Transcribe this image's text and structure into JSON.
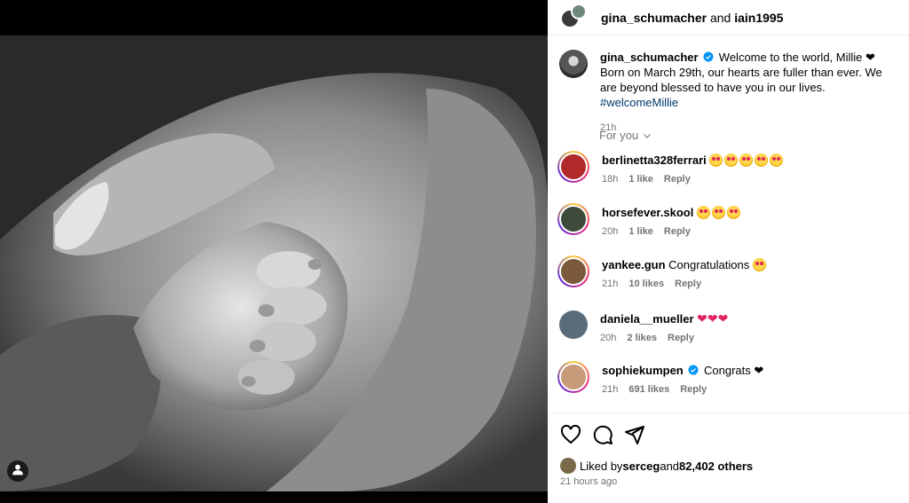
{
  "post": {
    "header_user1": "gina_schumacher",
    "header_and": " and ",
    "header_user2": "iain1995",
    "author": "gina_schumacher",
    "caption_text": "Welcome to the world, Millie ❤ Born on March 29th, our hearts are fuller than ever. We are beyond blessed to have you in our lives.",
    "hashtag": "#welcomeMillie",
    "caption_time": "21h",
    "for_you_label": "For you"
  },
  "comments": [
    {
      "user": "berlinetta328ferrari",
      "text": "",
      "emojis": 5,
      "time": "18h",
      "likes": "1 like",
      "reply": "Reply"
    },
    {
      "user": "horsefever.skool",
      "text": "",
      "emojis": 3,
      "time": "20h",
      "likes": "1 like",
      "reply": "Reply"
    },
    {
      "user": "yankee.gun",
      "text": "Congratulations",
      "emojis": 1,
      "time": "21h",
      "likes": "10 likes",
      "reply": "Reply"
    },
    {
      "user": "daniela__mueller",
      "text": "❤❤❤",
      "emojis": 0,
      "time": "20h",
      "likes": "2 likes",
      "reply": "Reply"
    },
    {
      "user": "sophiekumpen",
      "text": "Congrats ❤",
      "emojis": 0,
      "time": "21h",
      "likes": "691 likes",
      "reply": "Reply"
    }
  ],
  "likes": {
    "prefix": "Liked by ",
    "user": "serceg",
    "middle": " and ",
    "count": "82,402 others"
  },
  "posted_ago": "21 hours ago",
  "icons": [
    "heart-icon",
    "comment-icon",
    "share-icon",
    "user-tag-icon",
    "verified-badge-icon",
    "chevron-down-icon"
  ],
  "colors": {
    "hashtag": "#00376b",
    "meta": "#737373",
    "verified": "#0095f6"
  }
}
